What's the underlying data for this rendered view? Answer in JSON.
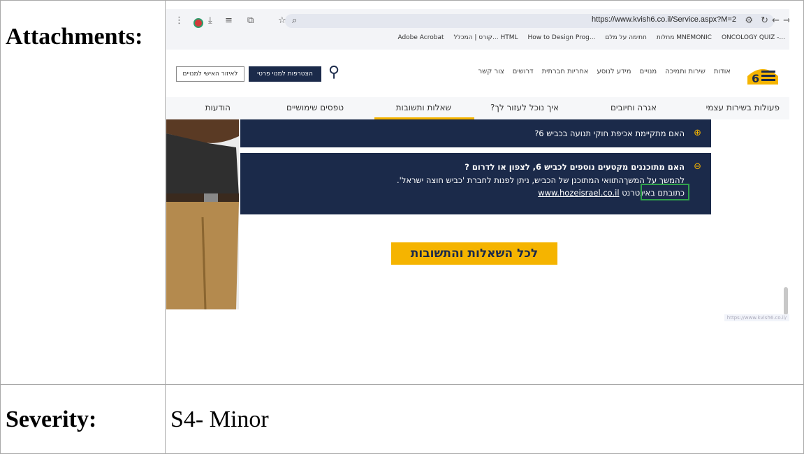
{
  "table": {
    "attachments_label": "Attachments:",
    "severity_label": "Severity:",
    "severity_value": "S4- Minor"
  },
  "browser": {
    "url": "https://www.kvish6.co.il/Service.aspx?M=2",
    "bookmarks": [
      "ONCOLOGY QUIZ -...",
      "מחלות MNEMONIC",
      "חתימה על מלם",
      "How to Design Prog...",
      "קורס | המכלל... HTML",
      "Adobe Acrobat"
    ]
  },
  "site": {
    "nav": [
      "אודות",
      "שירות ותמיכה",
      "מנויים",
      "מידע לנוסע",
      "אחריות חברתית",
      "דרושים",
      "צור קשר"
    ],
    "join_button": "הצטרפות למנוי פרטי",
    "personal_area": "לאיזור האישי למנויים",
    "tabs": [
      "פעולות בשירות עצמי",
      "אגרה וחיובים",
      "איך נוכל לעזור לך?",
      "שאלות ותשובות",
      "טפסים שימושיים",
      "הודעות"
    ],
    "faq1_question": "האם מתקיימת אכיפת חוקי תנועה בכביש 6?",
    "faq2_question": "האם מתוכננים מקטעים נוספים לכביש 6, לצפון או לדרום ?",
    "faq2_answer_highlight": "להמשך על המשך",
    "faq2_answer_rest": "התוואי המתוכנן של הכביש, ניתן לפנות לחברת 'כביש חוצה ישראל'.",
    "faq2_answer_line2": "כתובתם באינטרנט",
    "faq2_link": "www.hozeisrael.co.il",
    "all_faq_button": "לכל השאלות והתשובות",
    "status_url": "https://www.kvish6.co.il/"
  }
}
